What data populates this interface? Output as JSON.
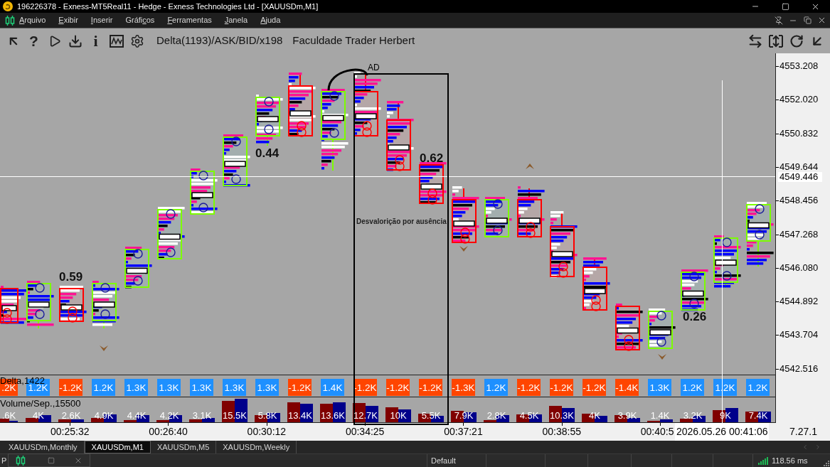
{
  "window": {
    "title": "196226378 - Exness-MT5Real11 - Hedge - Exness Technologies Ltd - [XAUUSDm,M1]"
  },
  "menu": [
    {
      "accel": "A",
      "after": "rquivo"
    },
    {
      "accel": "E",
      "after": "xibir"
    },
    {
      "accel": "I",
      "after": "nserir"
    },
    {
      "before": "Gráfi",
      "accel": "c",
      "after": "os"
    },
    {
      "accel": "F",
      "after": "erramentas"
    },
    {
      "accel": "J",
      "after": "anela"
    },
    {
      "accel": "A",
      "after": "juda"
    }
  ],
  "toolbar": {
    "help_glyph": "?",
    "info_glyph": "i",
    "indicator_label": "Delta(1193)/ASK/BID/x198",
    "comment": "Faculdade Trader Herbert"
  },
  "chart": {
    "ratio_labels": [
      "0.59",
      "0.44",
      "0.62",
      "0.26"
    ],
    "zone_label": "AD",
    "zone_note": "Desvalorição por ausência",
    "price_axis": [
      "4553.208",
      "4552.020",
      "4550.832",
      "4549.644",
      "4548.456",
      "4547.268",
      "4546.080",
      "4544.892",
      "4543.704",
      "4542.516"
    ],
    "crosshair_price": "4549.446",
    "time_axis": [
      "00:25:32",
      "00:26:40",
      "00:30:12",
      "00:34:25",
      "00:37:21",
      "00:38:55",
      "00:40:5"
    ],
    "crosshair_time": "2026.05.26 00:41:06",
    "axis_corner_text": "7.27.1"
  },
  "delta_panel": {
    "title": "Delta,1422",
    "bars": [
      {
        "label": ".2K",
        "kind": "negative"
      },
      {
        "label": "1.2K",
        "kind": "positive"
      },
      {
        "label": "-1.2K",
        "kind": "negative"
      },
      {
        "label": "1.2K",
        "kind": "positive"
      },
      {
        "label": "1.3K",
        "kind": "positive"
      },
      {
        "label": "1.3K",
        "kind": "positive"
      },
      {
        "label": "1.3K",
        "kind": "positive"
      },
      {
        "label": "1.3K",
        "kind": "positive"
      },
      {
        "label": "1.3K",
        "kind": "positive"
      },
      {
        "label": "-1.2K",
        "kind": "negative"
      },
      {
        "label": "1.4K",
        "kind": "positive"
      },
      {
        "label": "-1.2K",
        "kind": "negative"
      },
      {
        "label": "-1.2K",
        "kind": "negative"
      },
      {
        "label": "-1.2K",
        "kind": "negative"
      },
      {
        "label": "-1.3K",
        "kind": "negative"
      },
      {
        "label": "1.2K",
        "kind": "positive"
      },
      {
        "label": "-1.2K",
        "kind": "negative"
      },
      {
        "label": "-1.2K",
        "kind": "negative"
      },
      {
        "label": "-1.2K",
        "kind": "negative"
      },
      {
        "label": "-1.4K",
        "kind": "negative"
      },
      {
        "label": "1.3K",
        "kind": "positive"
      },
      {
        "label": "1.2K",
        "kind": "positive"
      },
      {
        "label": "1.2K",
        "kind": "positive"
      },
      {
        "label": "1.2K",
        "kind": "positive"
      }
    ]
  },
  "volume_panel": {
    "title": "Volume/Sep.,15500",
    "bars": [
      ".6K",
      "4K",
      "2.6K",
      "4.9K",
      "4.4K",
      "4.2K",
      "3.1K",
      "15.5K",
      "5.8K",
      "13.4K",
      "13.6K",
      "12.7K",
      "10K",
      "5.5K",
      "7.9K",
      "2.8K",
      "4.5K",
      "10.3K",
      "4K",
      "3.9K",
      "1.4K",
      "3.2K",
      "9K",
      "7.4K"
    ]
  },
  "tabs": [
    {
      "label": "XAUUSDm,Monthly",
      "selected": false
    },
    {
      "label": "XAUUSDm,M1",
      "selected": true
    },
    {
      "label": "XAUUSDm,M5",
      "selected": false
    },
    {
      "label": "XAUUSDm,Weekly",
      "selected": false
    }
  ],
  "status_bar": {
    "left_text": "P",
    "profile": "Default",
    "latency": "118.56 ms"
  }
}
